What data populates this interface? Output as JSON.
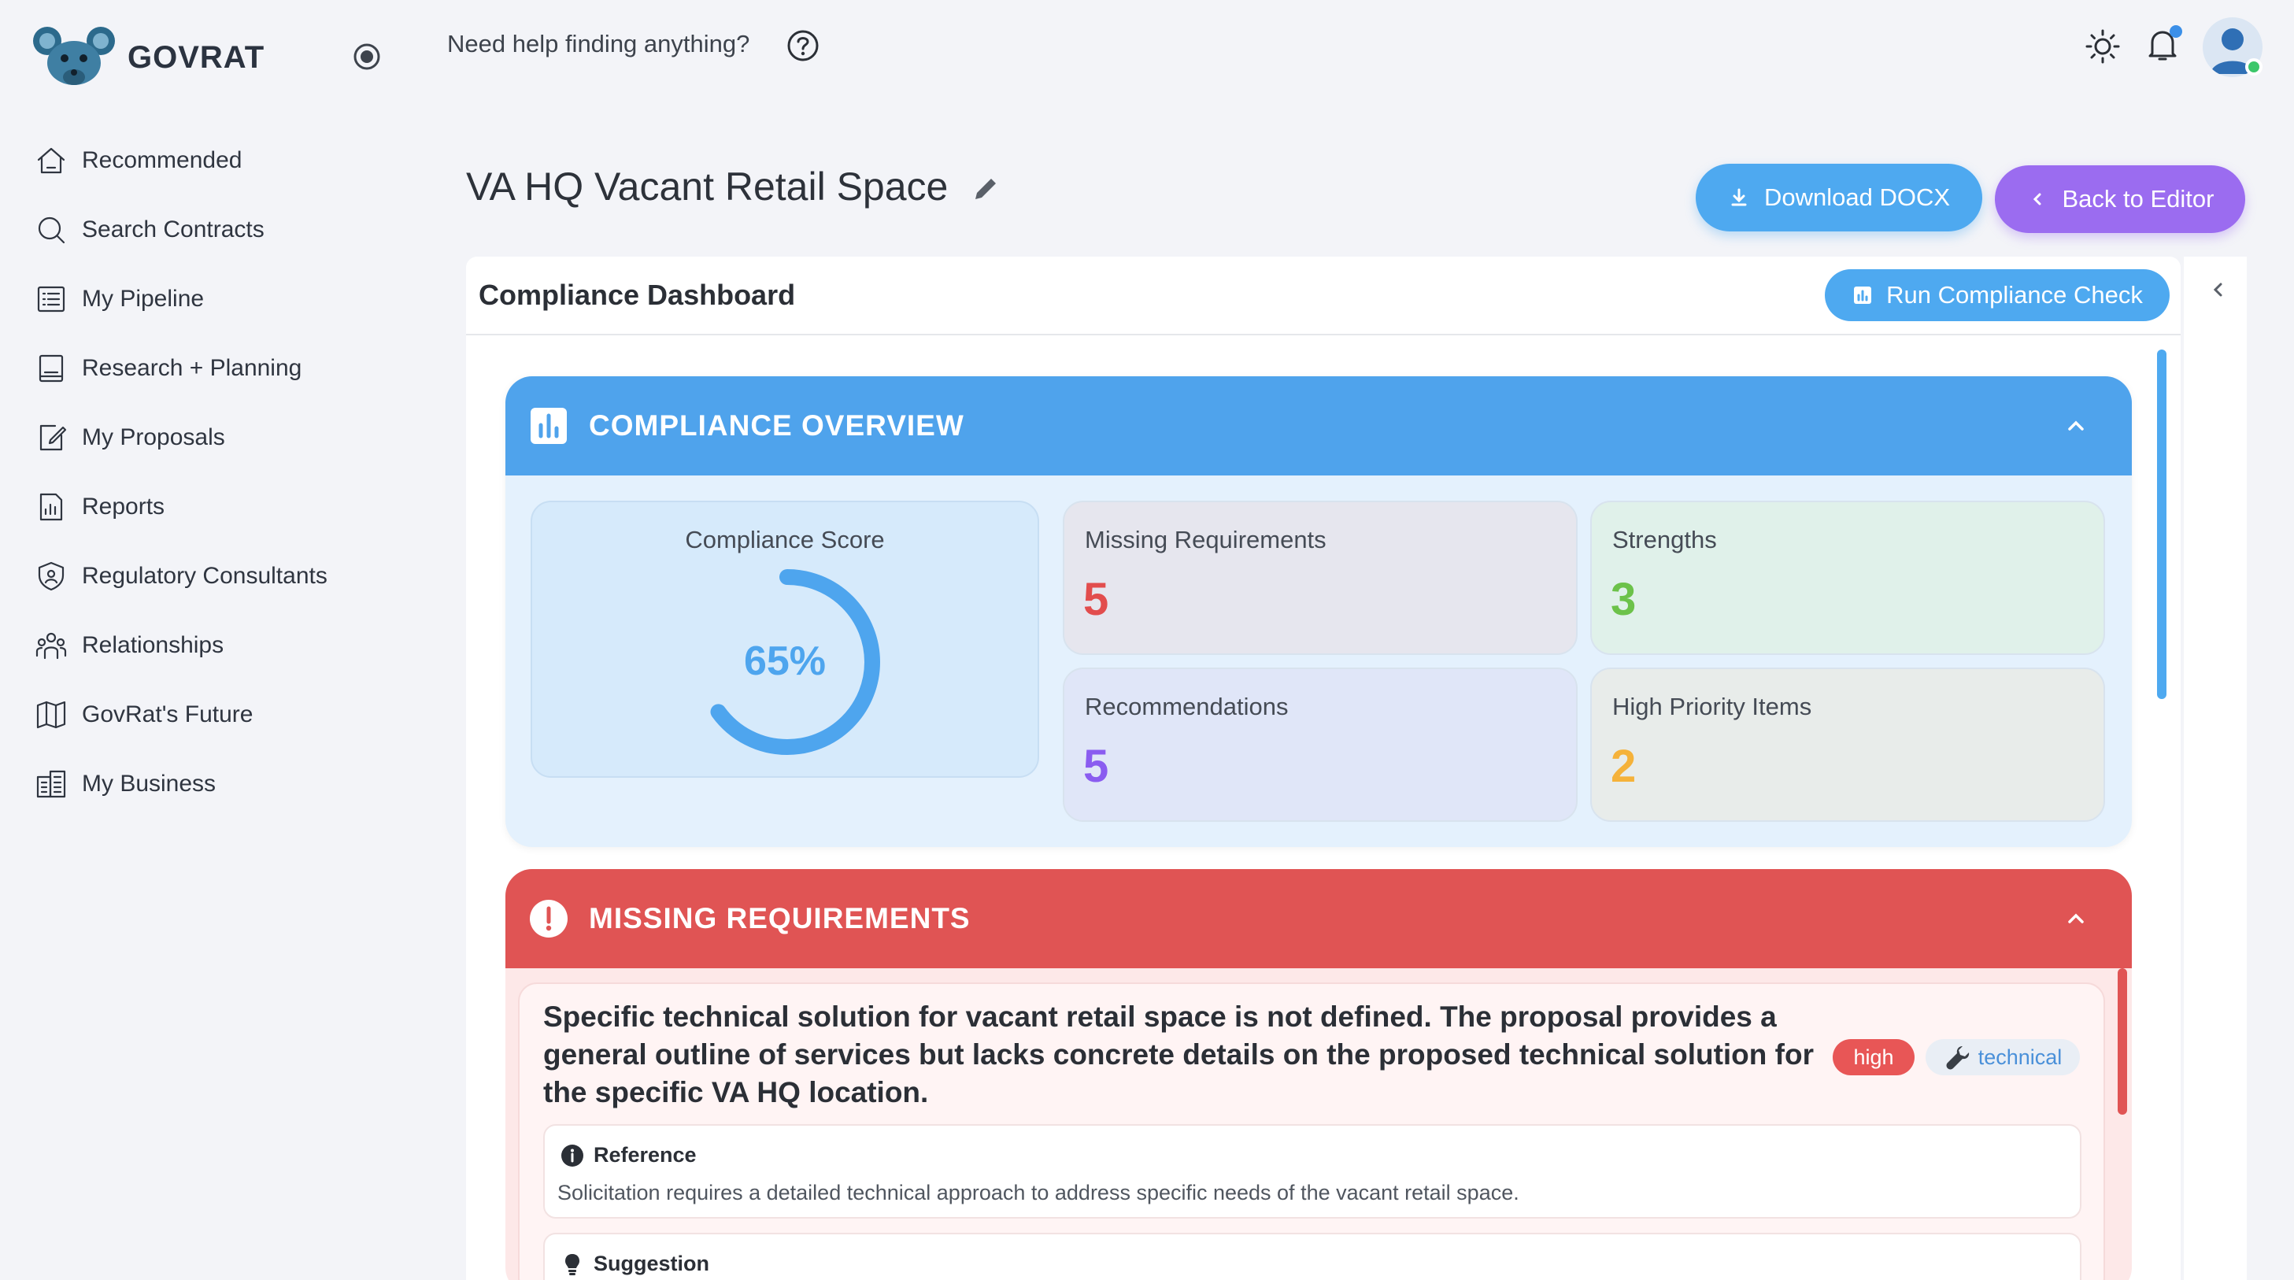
{
  "brand": {
    "name": "GOVRAT"
  },
  "header": {
    "help_text": "Need help finding anything?"
  },
  "sidebar": {
    "items": [
      {
        "label": "Recommended",
        "icon": "home-icon"
      },
      {
        "label": "Search Contracts",
        "icon": "search-icon"
      },
      {
        "label": "My Pipeline",
        "icon": "list-icon"
      },
      {
        "label": "Research + Planning",
        "icon": "book-icon"
      },
      {
        "label": "My Proposals",
        "icon": "edit-document-icon"
      },
      {
        "label": "Reports",
        "icon": "report-icon"
      },
      {
        "label": "Regulatory Consultants",
        "icon": "shield-user-icon"
      },
      {
        "label": "Relationships",
        "icon": "people-icon"
      },
      {
        "label": "GovRat's Future",
        "icon": "map-icon"
      },
      {
        "label": "My Business",
        "icon": "building-icon"
      }
    ]
  },
  "page": {
    "title": "VA HQ Vacant Retail Space",
    "download_label": "Download DOCX",
    "back_label": "Back to Editor"
  },
  "dashboard": {
    "title": "Compliance Dashboard",
    "run_label": "Run Compliance Check",
    "overview": {
      "title": "COMPLIANCE OVERVIEW",
      "score_label": "Compliance Score",
      "score_text": "65%",
      "score_fraction": 0.65,
      "missing_label": "Missing Requirements",
      "missing_value": "5",
      "strengths_label": "Strengths",
      "strengths_value": "3",
      "recommendations_label": "Recommendations",
      "recommendations_value": "5",
      "high_priority_label": "High Priority Items",
      "high_priority_value": "2"
    },
    "missing": {
      "title": "MISSING REQUIREMENTS",
      "item": {
        "text": "Specific technical solution for vacant retail space is not defined. The proposal provides a general outline of services but lacks concrete details on the proposed technical solution for the specific VA HQ location.",
        "priority": "high",
        "category": "technical",
        "reference_title": "Reference",
        "reference_text": "Solicitation requires a detailed technical approach to address specific needs of the vacant retail space.",
        "suggestion_title": "Suggestion"
      }
    }
  },
  "colors": {
    "accent_blue": "#4ea9f0",
    "accent_purple": "#9b6cf0",
    "danger_red": "#e05454",
    "missing_value": "#e24d4d",
    "strengths_value": "#6cc24a",
    "recommendations_value": "#8a5cf0",
    "high_priority_value": "#f5b23a"
  }
}
